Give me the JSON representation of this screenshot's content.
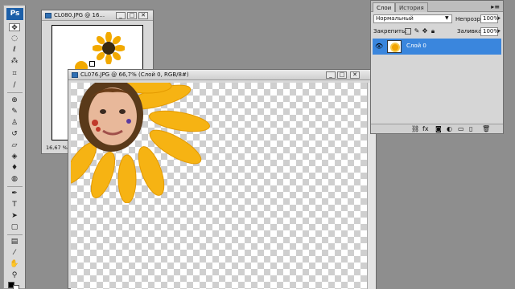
{
  "colors": {
    "accent": "#3a86dd",
    "ps_logo": "#1c5fa8",
    "petal": "#f6b313",
    "workspace": "#8e8e8e"
  },
  "toolbox": {
    "logo": "Ps",
    "tools": [
      "move-icon",
      "marquee-icon",
      "lasso-icon",
      "magic-wand-icon",
      "crop-icon",
      "slice-icon",
      "healing-icon",
      "brush-icon",
      "stamp-icon",
      "history-brush-icon",
      "eraser-icon",
      "bucket-icon",
      "blur-icon",
      "dodge-icon",
      "pen-icon",
      "type-icon",
      "path-select-icon",
      "shape-icon",
      "notes-icon",
      "eyedropper-icon",
      "hand-icon",
      "zoom-icon"
    ]
  },
  "doc_back": {
    "title": "CL080.JPG @ 16...",
    "zoom": "16,67 %"
  },
  "doc_front": {
    "title": "CL076.JPG @ 66,7% (Слой 0, RGB/8#)"
  },
  "panel": {
    "tabs": [
      "Слои",
      "История"
    ],
    "blend_mode": "Нормальный",
    "opacity_label": "Непрозр.:",
    "opacity_value": "100%",
    "lock_label": "Закрепить:",
    "fill_label": "Заливка:",
    "fill_value": "100%",
    "layer_name": "Слой 0"
  }
}
